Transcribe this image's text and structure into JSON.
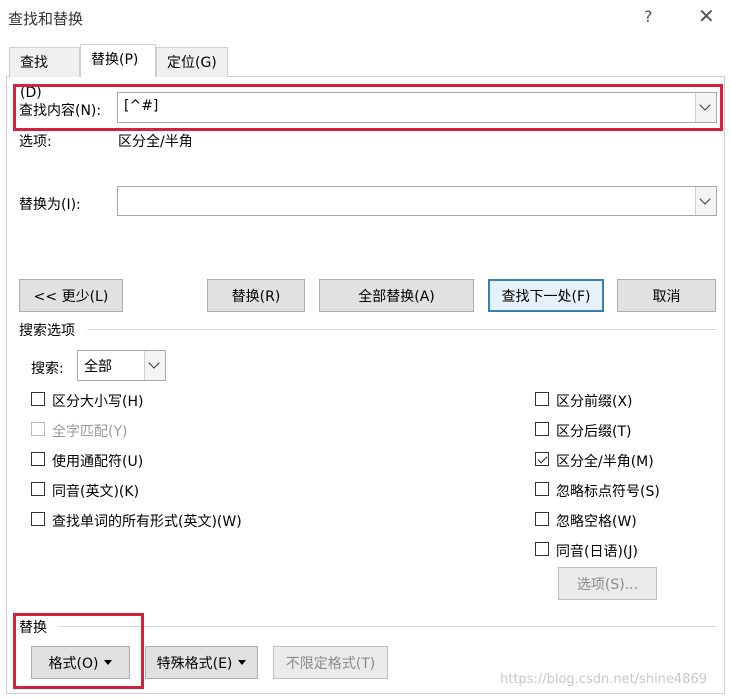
{
  "window": {
    "title": "查找和替换",
    "help": "?",
    "close": "✕"
  },
  "tabs": [
    {
      "label": "查找(D)",
      "active": false
    },
    {
      "label": "替换(P)",
      "active": true
    },
    {
      "label": "定位(G)",
      "active": false
    }
  ],
  "find": {
    "label": "查找内容(N):",
    "value": "[^#]"
  },
  "options_line": {
    "label": "选项:",
    "value": "区分全/半角"
  },
  "replace": {
    "label": "替换为(I):",
    "value": ""
  },
  "buttons": {
    "less": "<< 更少(L)",
    "replace": "替换(R)",
    "replace_all": "全部替换(A)",
    "find_next": "查找下一处(F)",
    "cancel": "取消"
  },
  "search_options": {
    "heading": "搜索选项",
    "search_label": "搜索:",
    "search_value": "全部",
    "left": [
      {
        "label": "区分大小写(H)",
        "checked": false,
        "disabled": false
      },
      {
        "label": "全字匹配(Y)",
        "checked": false,
        "disabled": true
      },
      {
        "label": "使用通配符(U)",
        "checked": false,
        "disabled": false
      },
      {
        "label": "同音(英文)(K)",
        "checked": false,
        "disabled": false
      },
      {
        "label": "查找单词的所有形式(英文)(W)",
        "checked": false,
        "disabled": false
      }
    ],
    "right": [
      {
        "label": "区分前缀(X)",
        "checked": false,
        "disabled": false
      },
      {
        "label": "区分后缀(T)",
        "checked": false,
        "disabled": false
      },
      {
        "label": "区分全/半角(M)",
        "checked": true,
        "disabled": false
      },
      {
        "label": "忽略标点符号(S)",
        "checked": false,
        "disabled": false
      },
      {
        "label": "忽略空格(W)",
        "checked": false,
        "disabled": false
      },
      {
        "label": "同音(日语)(J)",
        "checked": false,
        "disabled": false
      }
    ],
    "options_button": "选项(S)..."
  },
  "replace_section": {
    "heading": "替换",
    "format_button": "格式(O)",
    "special_button": "特殊格式(E)",
    "no_format_button": "不限定格式(T)"
  },
  "watermark": "https://blog.csdn.net/shine4869",
  "colors": {
    "highlight_red": "#d4213d",
    "primary_border": "#3c7fb1"
  }
}
